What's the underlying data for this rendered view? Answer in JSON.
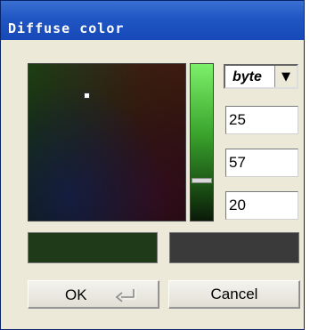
{
  "window": {
    "title": "Diffuse color"
  },
  "picker": {
    "format_label": "byte",
    "format_arrow": "▼",
    "values": [
      "25",
      "57",
      "20"
    ]
  },
  "swatches": {
    "new_color": "#1e3a19",
    "old_color": "#3a3a3a"
  },
  "buttons": {
    "ok_label": "OK",
    "cancel_label": "Cancel"
  }
}
